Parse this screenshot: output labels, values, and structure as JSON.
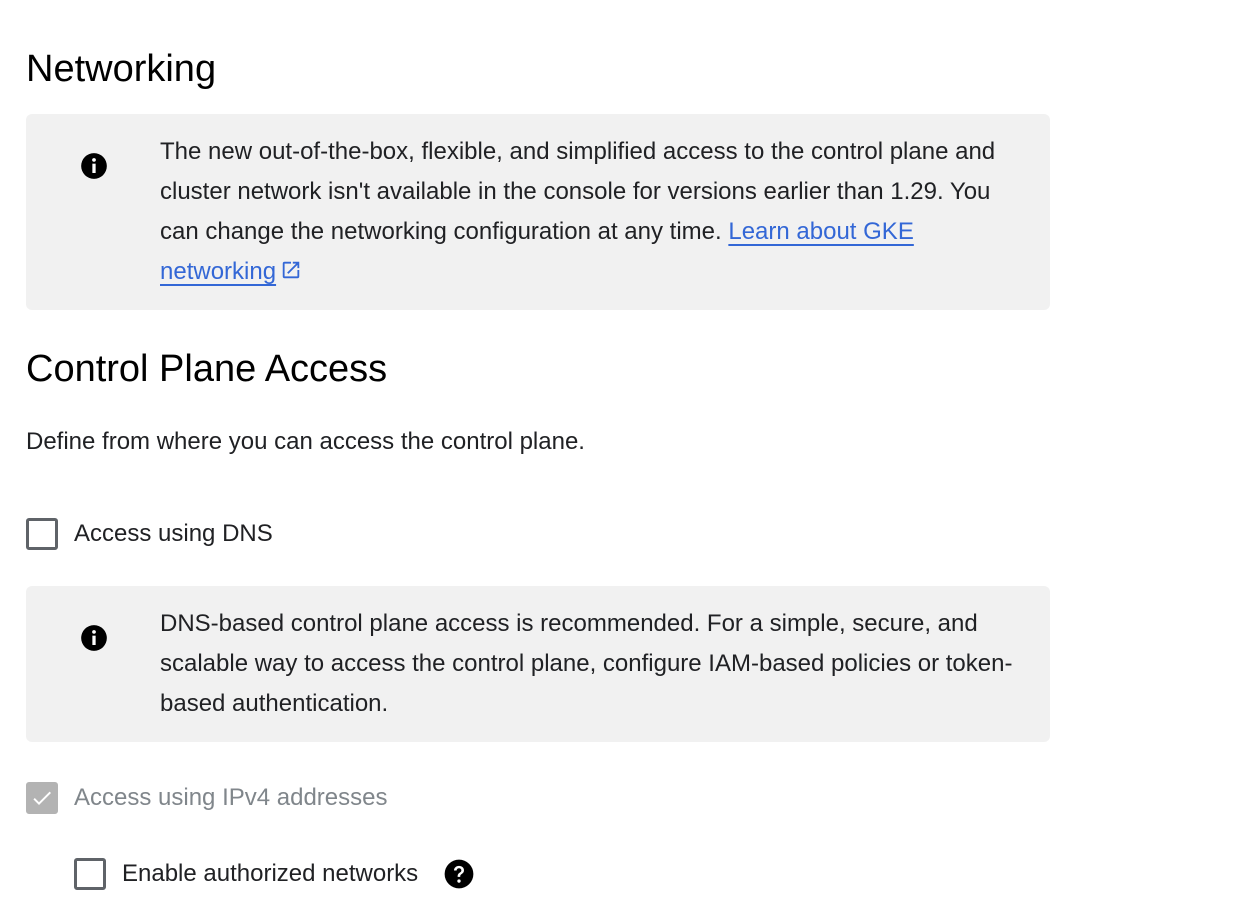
{
  "networking": {
    "title": "Networking",
    "info": {
      "text": "The new out-of-the-box, flexible, and simplified access to the control plane and cluster network isn't available in the console for versions earlier than 1.29. You can change the networking configuration at any time.",
      "link_label": "Learn about GKE networking",
      "icon": "info-icon",
      "link_icon": "open-in-new-icon"
    }
  },
  "control_plane": {
    "title": "Control Plane Access",
    "description": "Define from where you can access the control plane.",
    "dns_checkbox": {
      "label": "Access using DNS",
      "checked": false
    },
    "dns_info": {
      "text": "DNS-based control plane access is recommended. For a simple, secure, and scalable way to access the control plane, configure IAM-based policies or token-based authentication.",
      "icon": "info-icon"
    },
    "ipv4_checkbox": {
      "label": "Access using IPv4 addresses",
      "checked": true,
      "disabled": true
    },
    "authorized_networks_checkbox": {
      "label": "Enable authorized networks",
      "checked": false,
      "help_icon": "help-icon"
    }
  },
  "colors": {
    "link": "#3367d6",
    "info_bg": "#f1f1f1",
    "disabled": "#b3b3b3"
  }
}
